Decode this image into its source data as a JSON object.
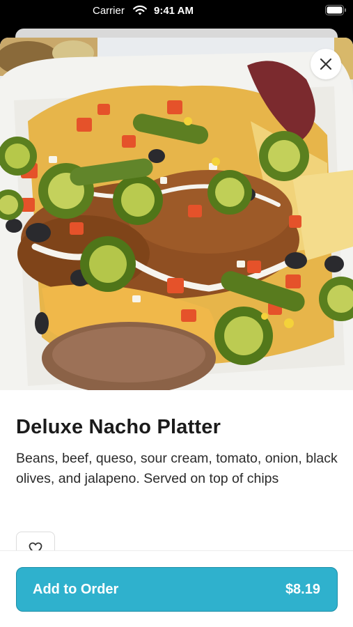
{
  "status_bar": {
    "carrier": "Carrier",
    "time": "9:41 AM"
  },
  "item": {
    "title": "Deluxe Nacho Platter",
    "description": "Beans, beef, queso, sour cream, tomato, onion, black olives, and jalapeno. Served on top of chips",
    "image_icon": "nacho-platter-photo"
  },
  "actions": {
    "close_icon": "close-icon",
    "favorite_icon": "heart-icon",
    "add_label": "Add to Order",
    "price": "$8.19"
  },
  "colors": {
    "accent": "#2fb1cd",
    "accent_border": "#1e8fa8"
  }
}
